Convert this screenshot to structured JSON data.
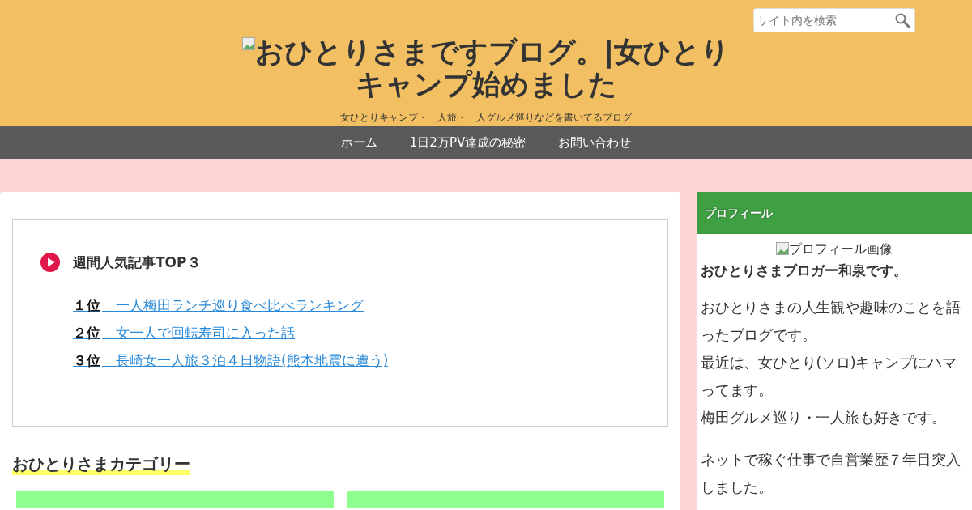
{
  "header": {
    "logo_alt": "おひとりさまですブログ。|女ひとりキャンプ始めました",
    "tagline": "女ひとりキャンプ・一人旅・一人グルメ巡りなどを書いてるブログ",
    "search": {
      "placeholder": "サイト内を検索"
    }
  },
  "nav": [
    {
      "label": "ホーム"
    },
    {
      "label": "1日2万PV達成の秘密"
    },
    {
      "label": "お問い合わせ"
    }
  ],
  "ranking": {
    "title": "週間人気記事TOP３",
    "items": [
      {
        "text": "**１位**　一人梅田ランチ巡り食べ比べランキング"
      },
      {
        "text": "**２位**　女一人で回転寿司に入った話"
      },
      {
        "text": "**３位**　長崎女一人旅３泊４日物語(熊本地震に遭う)"
      }
    ]
  },
  "category": {
    "heading": "おひとりさまカテゴリー",
    "cards": [
      {
        "kind": "tile"
      },
      {
        "kind": "tile"
      }
    ]
  },
  "sidebar": {
    "heading": "プロフィール",
    "image_alt": "プロフィール画像",
    "name": "おひとりさまブロガー和泉です。",
    "paragraphs": [
      [
        "おひとりさまの人生観や趣味のことを語ったブログです。",
        "最近は、女ひとり(ソロ)キャンプにハマってます。",
        "梅田グルメ巡り・一人旅も好きです。"
      ],
      [
        "ネットで稼ぐ仕事で自営業歴７年目突入しました。"
      ]
    ]
  }
}
